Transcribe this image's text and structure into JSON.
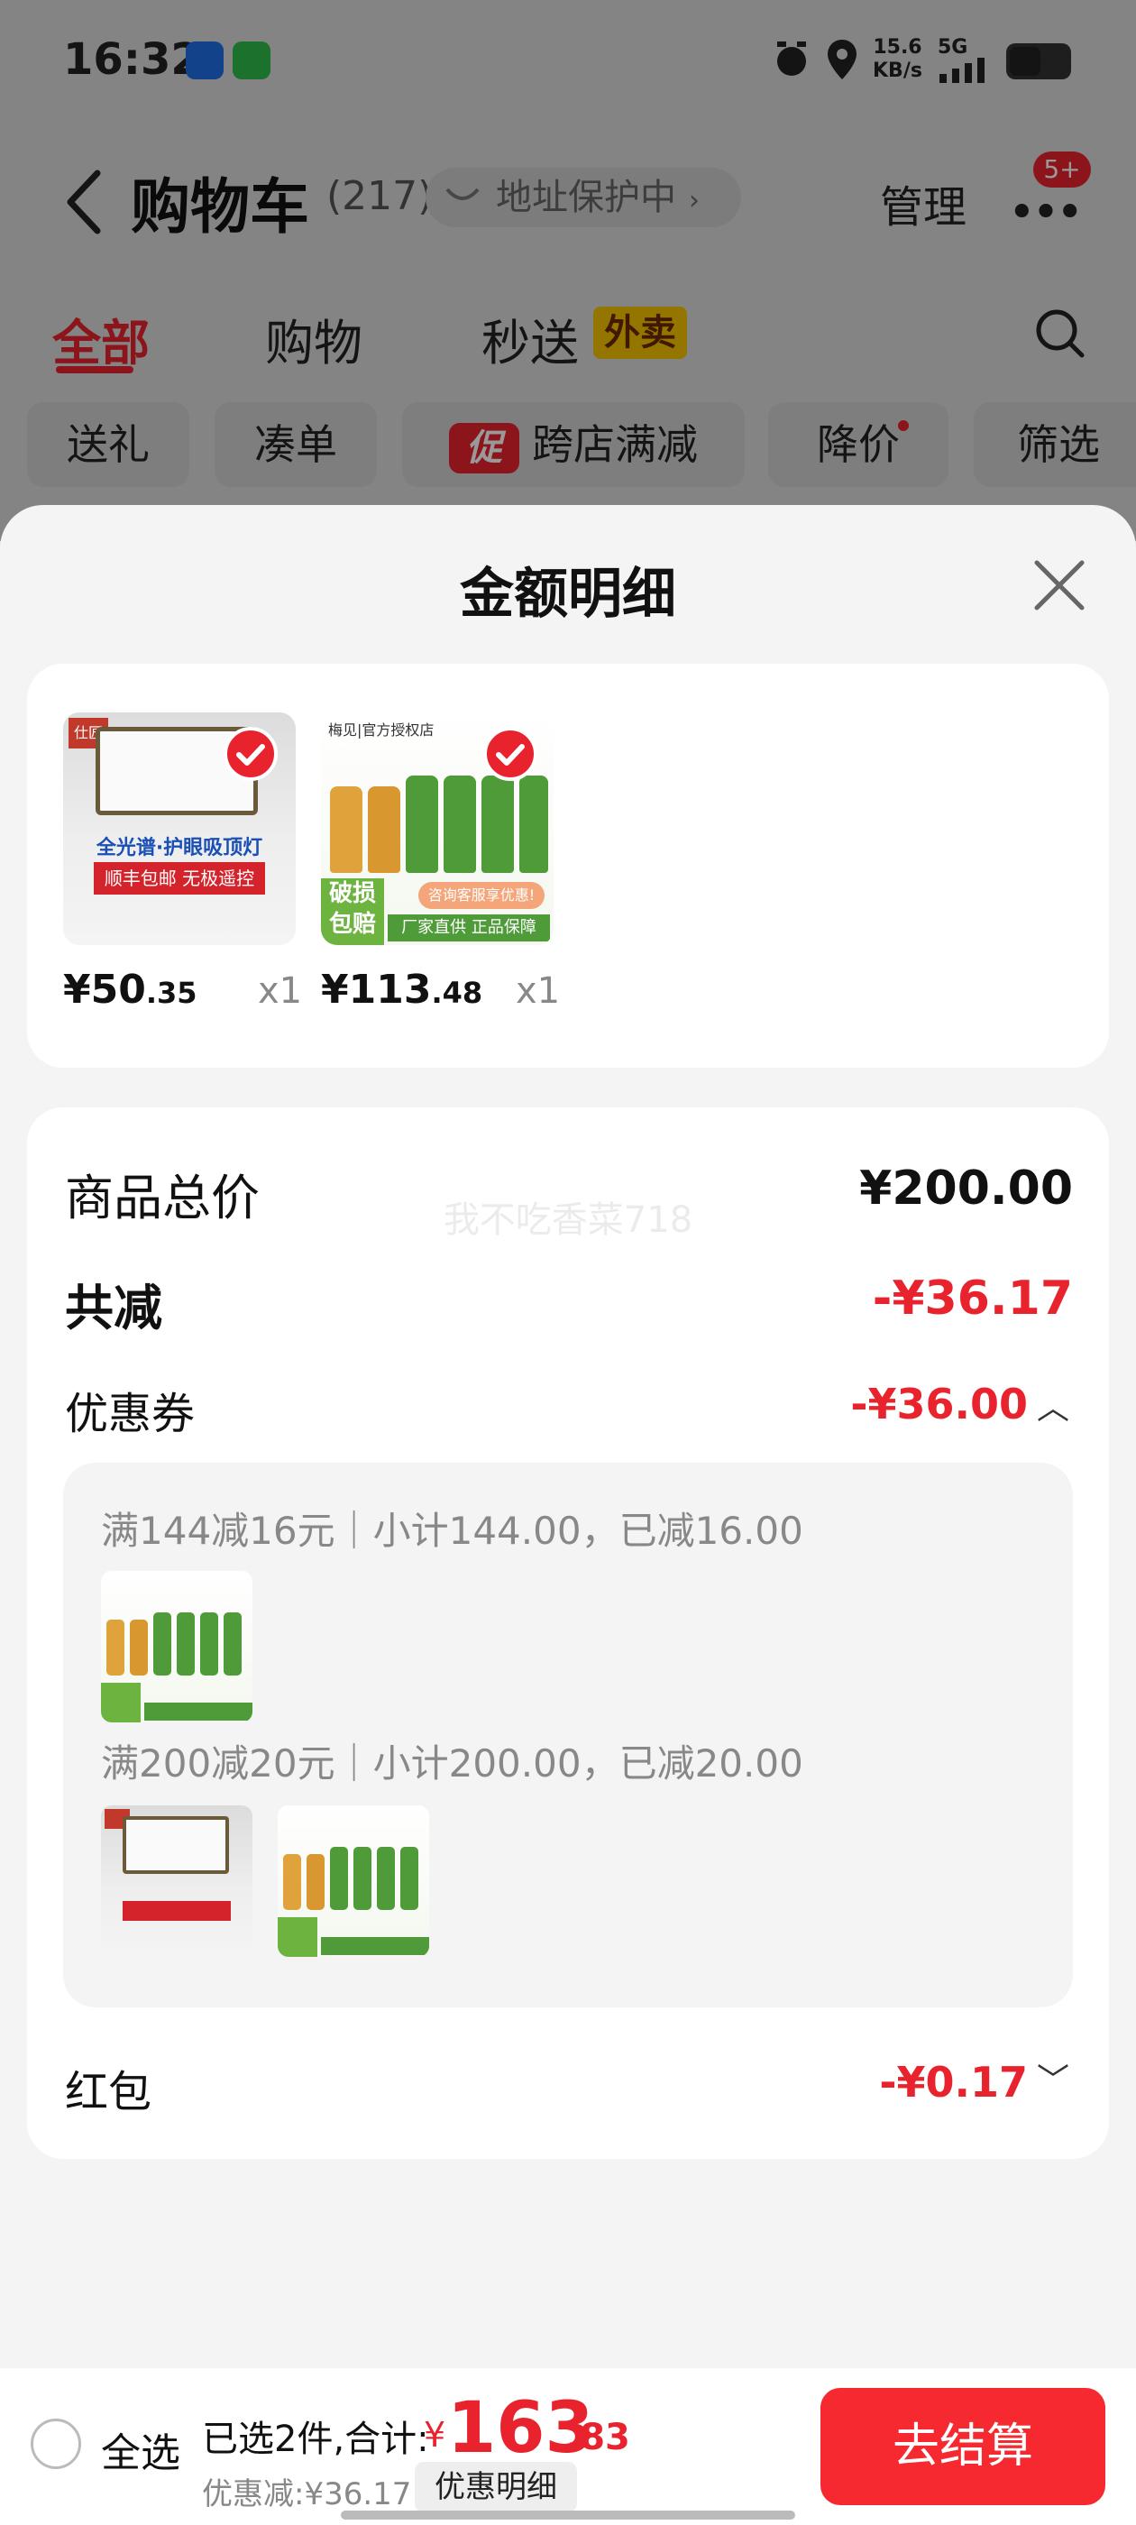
{
  "status_bar": {
    "time": "16:32",
    "network_speed_value": "15.6",
    "network_speed_unit": "KB/s",
    "network_type": "5G"
  },
  "header": {
    "title": "购物车",
    "count": "(217)",
    "address_label": "地址保护中",
    "manage_label": "管理",
    "more_badge": "5+"
  },
  "tabs": [
    {
      "label": "全部",
      "active": true
    },
    {
      "label": "购物",
      "active": false
    },
    {
      "label": "秒送",
      "active": false,
      "badge": "外卖"
    }
  ],
  "filters": [
    {
      "label": "送礼"
    },
    {
      "label": "凑单"
    },
    {
      "label": "跨店满减",
      "badge": "促"
    },
    {
      "label": "降价"
    },
    {
      "label": "筛选"
    }
  ],
  "sheet": {
    "title": "金额明细",
    "items": [
      {
        "price_int": "¥50",
        "price_dec": ".35",
        "qty": "x1",
        "image": "ceiling-lamp",
        "img_brand": "仕匠",
        "img_line1": "全光谱·护眼吸顶灯",
        "img_line2": "顺丰包邮 无极遥控"
      },
      {
        "price_int": "¥113",
        "price_dec": ".48",
        "qty": "x1",
        "image": "plum-wine-bottles",
        "img_store": "梅见|官方授权店",
        "img_tag1": "破损",
        "img_tag2": "包赔",
        "img_line": "厂家直供 正品保障",
        "img_consult": "咨询客服享优惠!"
      }
    ],
    "summary": {
      "total_label": "商品总价",
      "total_value": "¥200.00",
      "reduce_label": "共减",
      "reduce_value": "-¥36.17",
      "coupon_label": "优惠券",
      "coupon_value": "-¥36.00",
      "redpacket_label": "红包",
      "redpacket_value": "-¥0.17"
    },
    "coupon_details": [
      {
        "text": "满144减16元｜小计144.00，已减16.00"
      },
      {
        "text": "满200减20元｜小计200.00，已减20.00"
      }
    ],
    "watermark": "我不吃香菜718"
  },
  "bottom_bar": {
    "select_all": "全选",
    "selected_summary": "已选2件,合计:",
    "currency": "¥",
    "total_int": "163",
    "total_dec": ".83",
    "discount_text": "优惠减:¥36.17",
    "detail_button": "优惠明细",
    "checkout_button": "去结算"
  },
  "colors": {
    "accent": "#e8232d",
    "checkout": "#f5292f",
    "sheet_bg": "#f4f4f4"
  }
}
